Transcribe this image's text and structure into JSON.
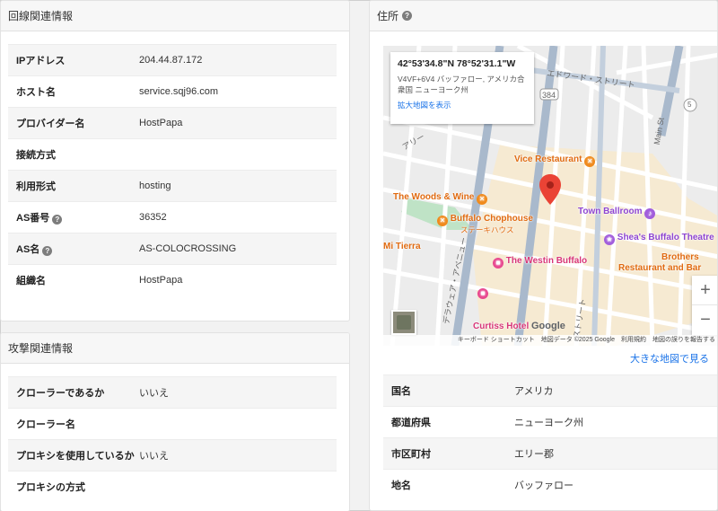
{
  "line_info": {
    "title": "回線関連情報",
    "rows": [
      {
        "label": "IPアドレス",
        "value": "204.44.87.172",
        "help": false
      },
      {
        "label": "ホスト名",
        "value": "service.sqj96.com",
        "help": false
      },
      {
        "label": "プロバイダー名",
        "value": "HostPapa",
        "help": false
      },
      {
        "label": "接続方式",
        "value": "",
        "help": false
      },
      {
        "label": "利用形式",
        "value": "hosting",
        "help": false
      },
      {
        "label": "AS番号",
        "value": "36352",
        "help": true
      },
      {
        "label": "AS名",
        "value": "AS-COLOCROSSING",
        "help": true
      },
      {
        "label": "組織名",
        "value": "HostPapa",
        "help": false
      }
    ]
  },
  "attack_info": {
    "title": "攻撃関連情報",
    "rows": [
      {
        "label": "クローラーであるか",
        "value": "いいえ"
      },
      {
        "label": "クローラー名",
        "value": ""
      },
      {
        "label": "プロキシを使用しているか",
        "value": "いいえ"
      },
      {
        "label": "プロキシの方式",
        "value": ""
      }
    ]
  },
  "address": {
    "title": "住所",
    "map": {
      "coords": "42°53'34.8\"N 78°52'31.1\"W",
      "address": "V4VF+6V4 バッファロー, アメリカ合衆国 ニューヨーク州",
      "view_larger_link": "拡大地図を表示",
      "google_logo": "Google",
      "attribution": "キーボード ショートカット　地図データ ©2025 Google　利用規約　地図の誤りを報告する",
      "zoom_in": "+",
      "zoom_out": "−",
      "pois": {
        "vice": "Vice Restaurant",
        "woods": "The Woods & Wine",
        "chophouse": "Buffalo Chophouse",
        "chophouse_sub": "ステーキハウス",
        "town_ballroom": "Town Ballroom",
        "sheas": "Shea's Buffalo Theatre",
        "mi_tierra": "Mi Tierra",
        "westin": "The Westin Buffalo",
        "brothers1": "Brothers",
        "brothers2": "Restaurant and Bar",
        "curtiss": "Curtiss Hotel"
      },
      "streets": {
        "edward": "エドワード・ストリート",
        "main": "Main St",
        "rt384": "384",
        "rt5": "5",
        "delaware": "デラウェア・アベニュー",
        "street_bottom": "ストリート",
        "ally": "アリー"
      }
    },
    "larger_map_link": "大きな地図で見る",
    "rows": [
      {
        "label": "国名",
        "value": "アメリカ"
      },
      {
        "label": "都道府県",
        "value": "ニューヨーク州"
      },
      {
        "label": "市区町村",
        "value": "エリー郡"
      },
      {
        "label": "地名",
        "value": "バッファロー"
      }
    ]
  }
}
